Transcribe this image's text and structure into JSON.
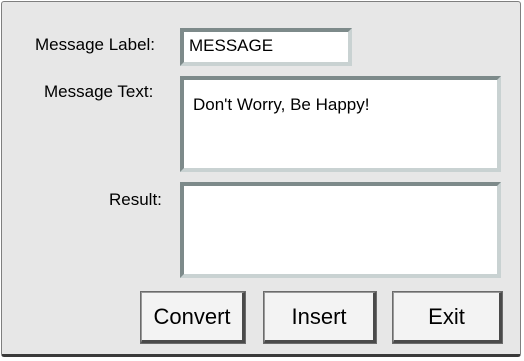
{
  "form": {
    "message_label": {
      "label": "Message Label:",
      "value": "MESSAGE"
    },
    "message_text": {
      "label": "Message Text:",
      "value": "Don't Worry, Be Happy!"
    },
    "result": {
      "label": "Result:",
      "value": ""
    }
  },
  "buttons": {
    "convert": "Convert",
    "insert": "Insert",
    "exit": "Exit"
  }
}
